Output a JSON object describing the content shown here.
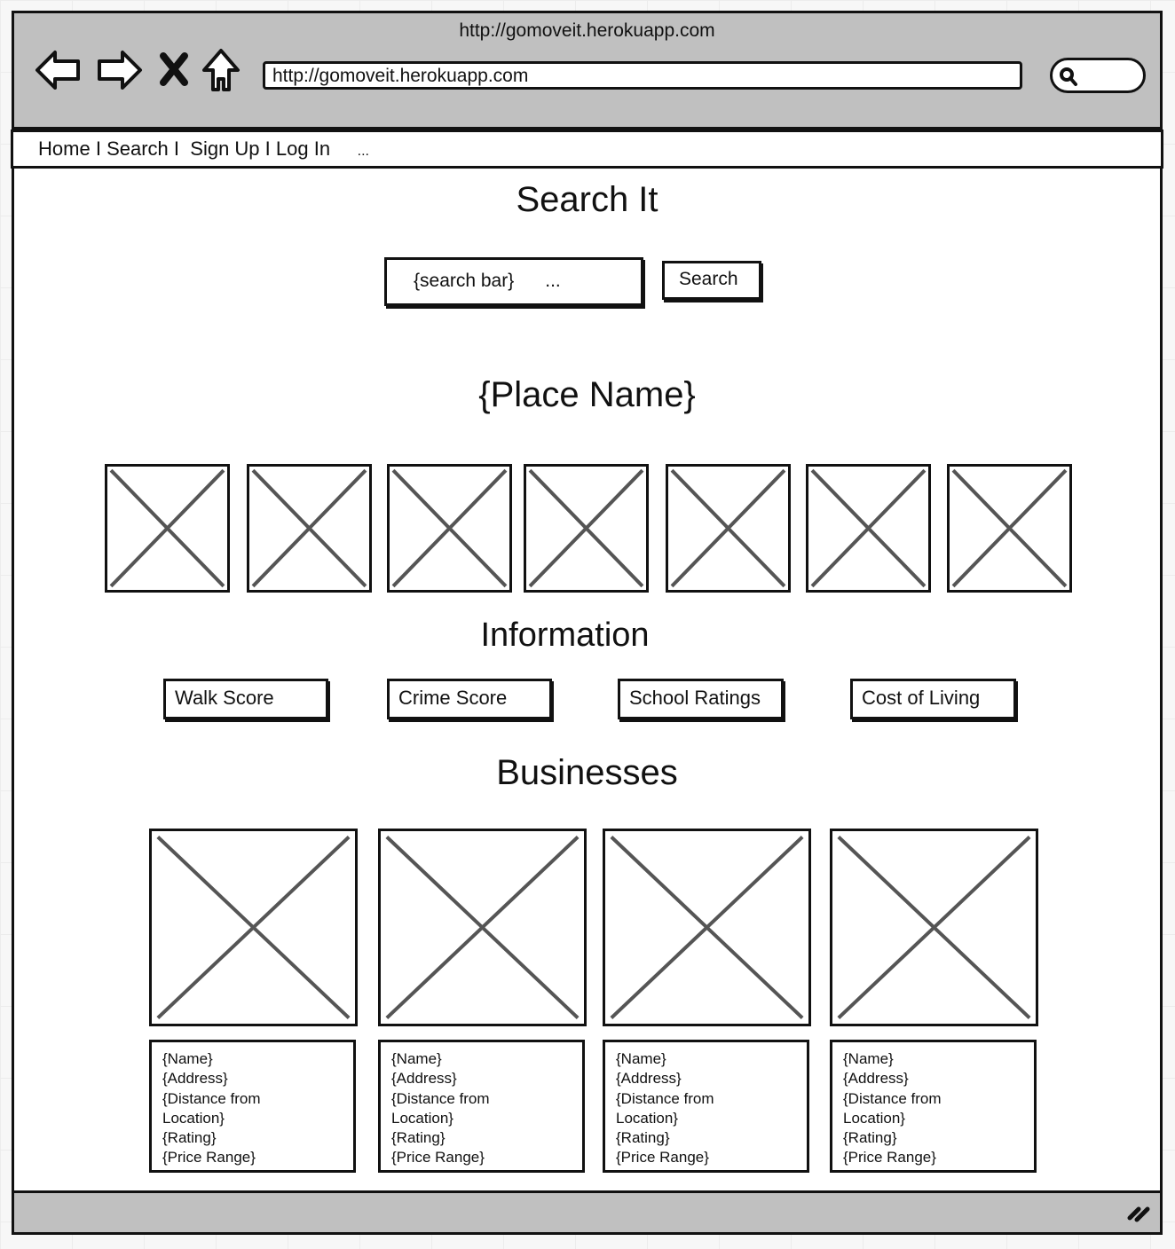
{
  "browser": {
    "window_title": "http://gomoveit.herokuapp.com",
    "url": "http://gomoveit.herokuapp.com",
    "icons": [
      "back-arrow-icon",
      "forward-arrow-icon",
      "stop-icon",
      "home-icon",
      "search-icon",
      "resize-grip-icon"
    ]
  },
  "nav": {
    "items": [
      "Home",
      "Search",
      "Sign Up",
      "Log In"
    ],
    "separator": "I",
    "more": "..."
  },
  "search_section": {
    "title": "Search It",
    "input_value": "{search bar}      ...",
    "button_label": "Search"
  },
  "place": {
    "title": "{Place Name}",
    "image_count": 7
  },
  "information": {
    "title": "Information",
    "buttons": [
      "Walk Score",
      "Crime Score",
      "School Ratings",
      "Cost of Living"
    ]
  },
  "businesses": {
    "title": "Businesses",
    "cards": [
      {
        "lines": [
          "{Name}",
          "{Address}",
          "{Distance from",
          "Location}",
          "{Rating}",
          "{Price Range}"
        ]
      },
      {
        "lines": [
          "{Name}",
          "{Address}",
          "{Distance from",
          "Location}",
          "{Rating}",
          "{Price Range}"
        ]
      },
      {
        "lines": [
          "{Name}",
          "{Address}",
          "{Distance from",
          "Location}",
          "{Rating}",
          "{Price Range}"
        ]
      },
      {
        "lines": [
          "{Name}",
          "{Address}",
          "{Distance from",
          "Location}",
          "{Rating}",
          "{Price Range}"
        ]
      }
    ]
  }
}
